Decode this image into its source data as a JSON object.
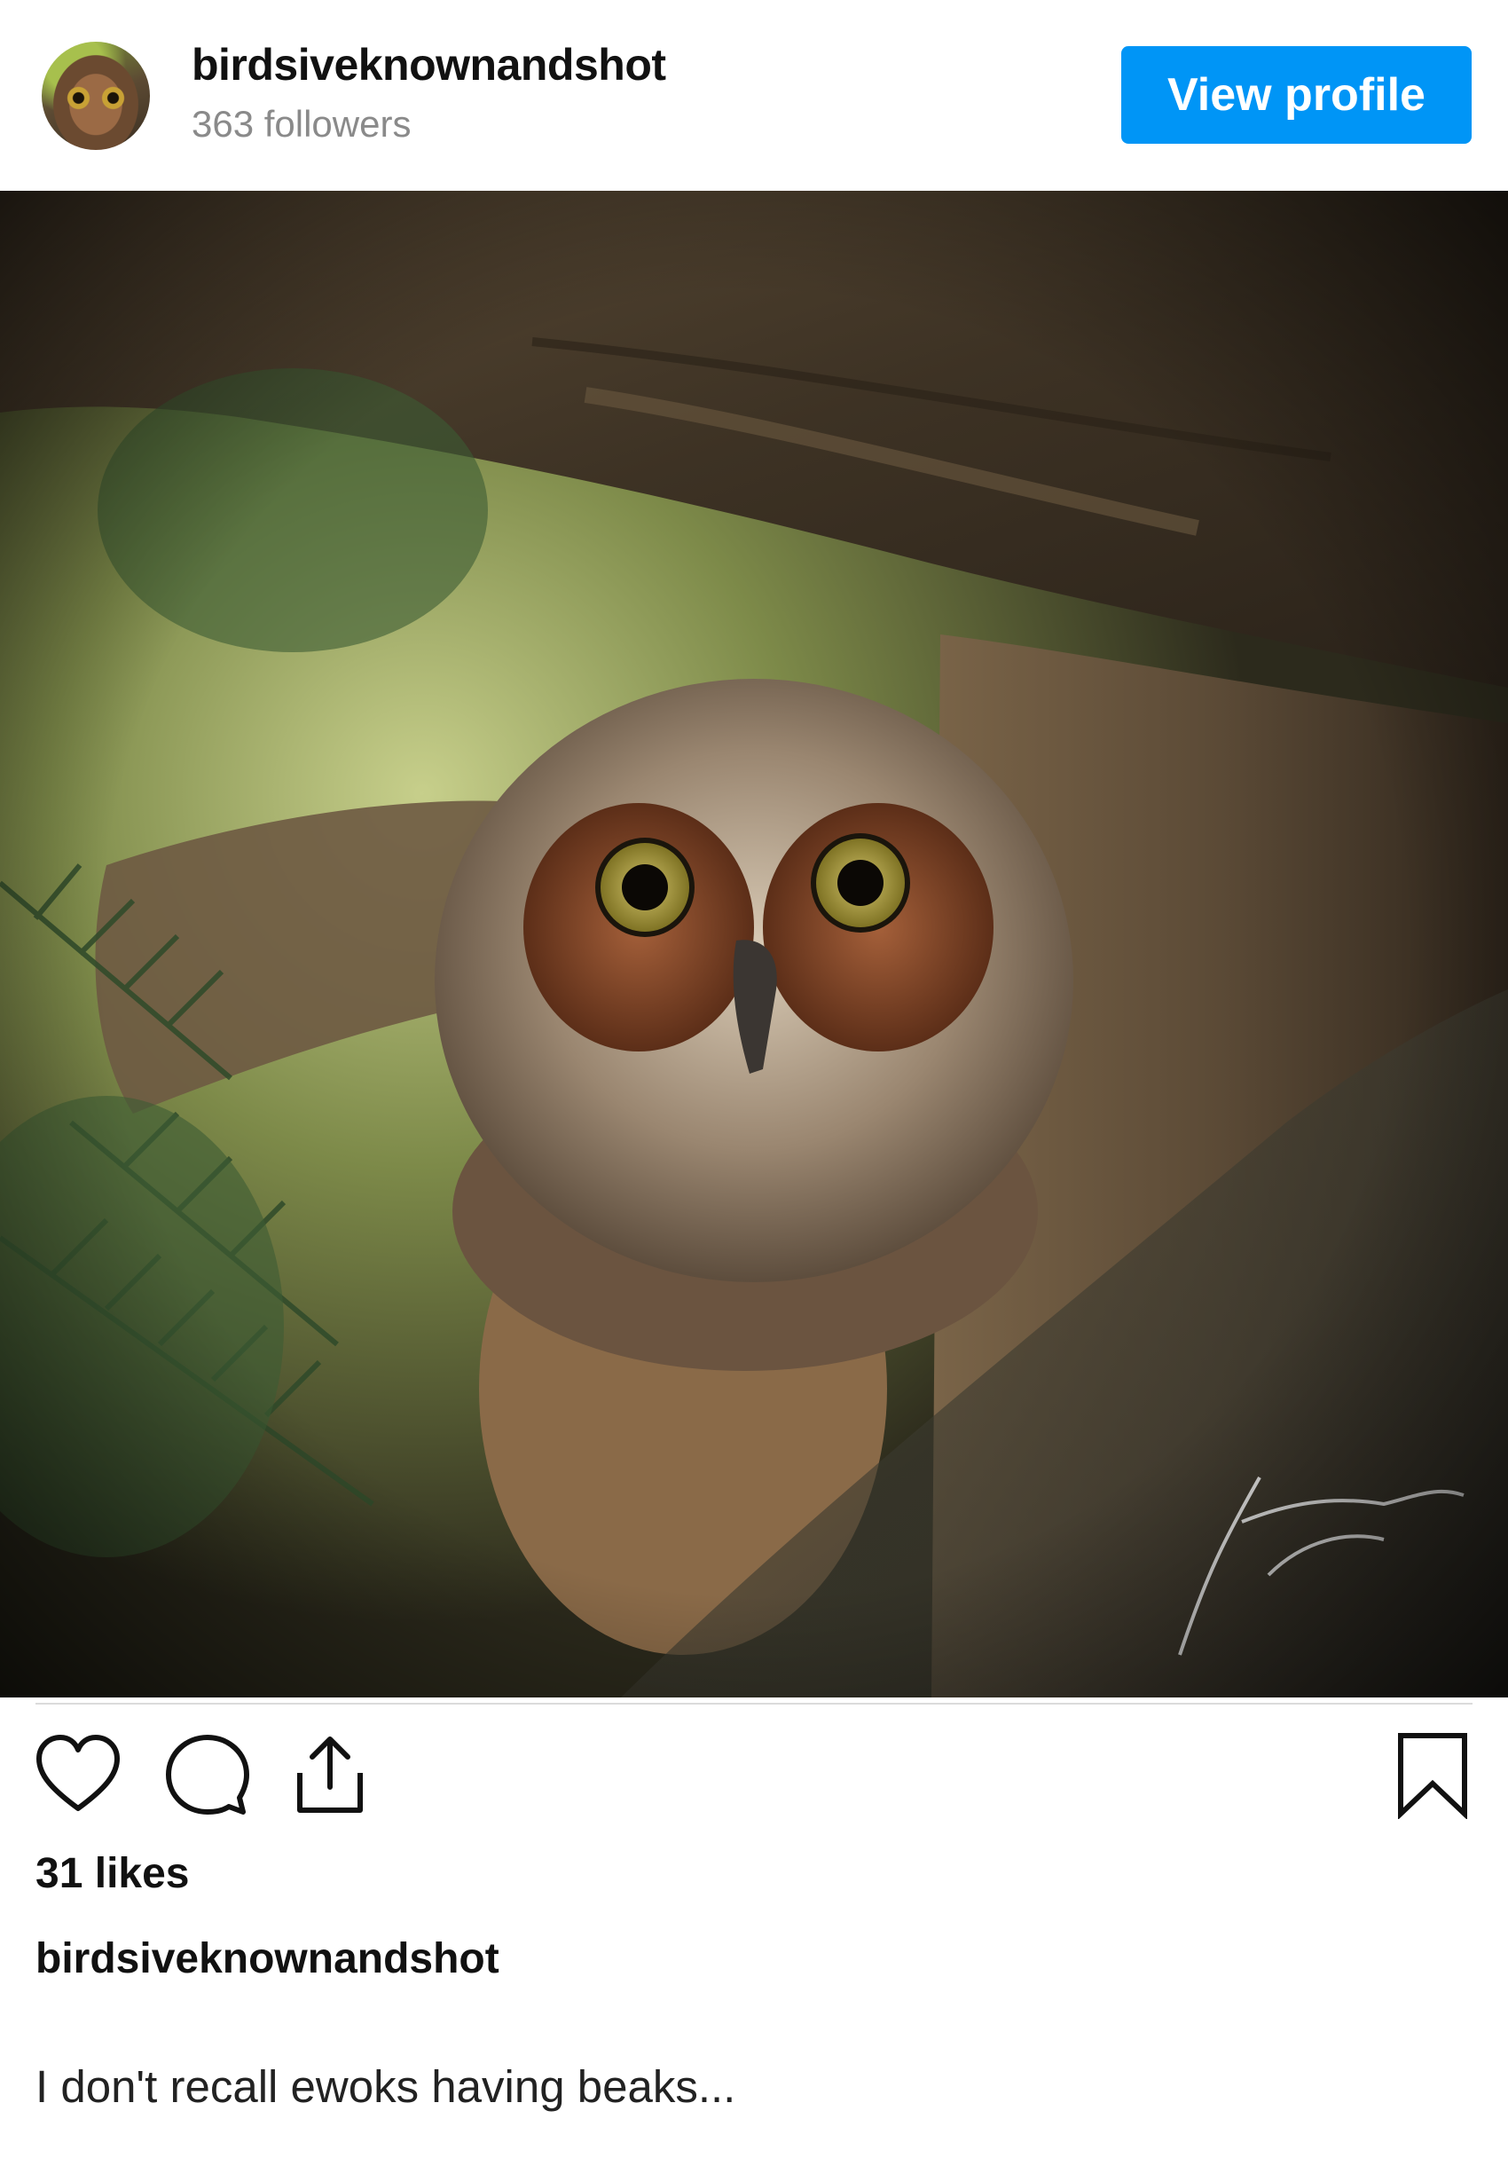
{
  "post": {
    "username": "birdsiveknownandshot",
    "followers": "363 followers",
    "view_profile_label": "View profile",
    "likes": "31 likes",
    "caption_user": "birdsiveknownandshot",
    "caption": "I don't recall ewoks having beaks..."
  },
  "image": {
    "subject": "young great horned owl among branches",
    "signature_text": "Jim Ashton"
  },
  "icons": {
    "like": "heart-outline",
    "comment": "speech-bubble-outline",
    "share": "upload-arrow",
    "save": "bookmark-outline"
  },
  "colors": {
    "accent": "#0095f6",
    "muted_text": "#8a8a8a"
  }
}
